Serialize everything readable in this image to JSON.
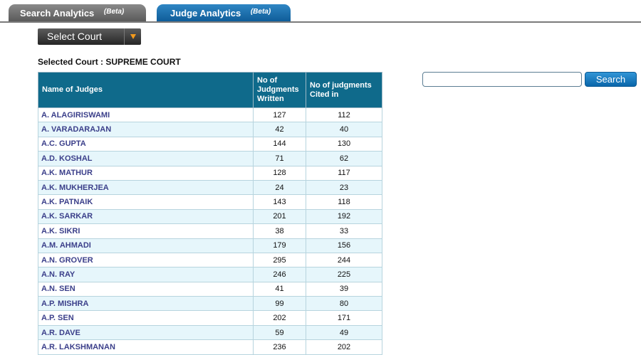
{
  "tabs": {
    "search": {
      "label": "Search Analytics",
      "beta": "(Beta)"
    },
    "judge": {
      "label": "Judge Analytics",
      "beta": "(Beta)"
    }
  },
  "select_court": {
    "label": "Select Court"
  },
  "selected_court": {
    "text": "Selected Court : SUPREME COURT"
  },
  "search": {
    "placeholder": "",
    "button_label": "Search"
  },
  "table": {
    "headers": [
      "Name of Judges",
      "No of Judgments Written",
      "No of judgments Cited in"
    ],
    "rows": [
      {
        "name": "A. ALAGIRISWAMI",
        "written": "127",
        "cited": "112"
      },
      {
        "name": "A. VARADARAJAN",
        "written": "42",
        "cited": "40"
      },
      {
        "name": "A.C. GUPTA",
        "written": "144",
        "cited": "130"
      },
      {
        "name": "A.D. KOSHAL",
        "written": "71",
        "cited": "62"
      },
      {
        "name": "A.K. MATHUR",
        "written": "128",
        "cited": "117"
      },
      {
        "name": "A.K. MUKHERJEA",
        "written": "24",
        "cited": "23"
      },
      {
        "name": "A.K. PATNAIK",
        "written": "143",
        "cited": "118"
      },
      {
        "name": "A.K. SARKAR",
        "written": "201",
        "cited": "192"
      },
      {
        "name": "A.K. SIKRI",
        "written": "38",
        "cited": "33"
      },
      {
        "name": "A.M. AHMADI",
        "written": "179",
        "cited": "156"
      },
      {
        "name": "A.N. GROVER",
        "written": "295",
        "cited": "244"
      },
      {
        "name": "A.N. RAY",
        "written": "246",
        "cited": "225"
      },
      {
        "name": "A.N. SEN",
        "written": "41",
        "cited": "39"
      },
      {
        "name": "A.P. MISHRA",
        "written": "99",
        "cited": "80"
      },
      {
        "name": "A.P. SEN",
        "written": "202",
        "cited": "171"
      },
      {
        "name": "A.R. DAVE",
        "written": "59",
        "cited": "49"
      },
      {
        "name": "A.R. LAKSHMANAN",
        "written": "236",
        "cited": "202"
      }
    ]
  }
}
